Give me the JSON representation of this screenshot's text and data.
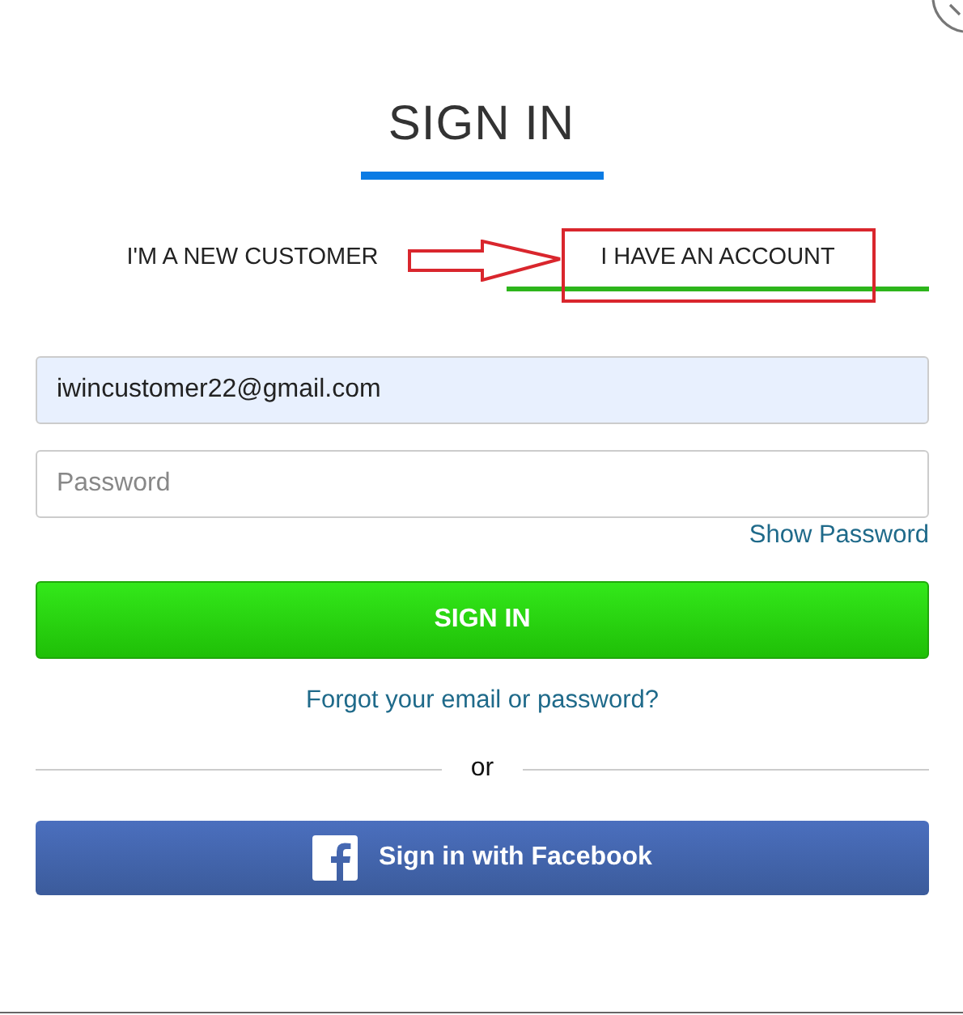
{
  "title": "SIGN IN",
  "tabs": [
    {
      "label": "I'M A NEW CUSTOMER",
      "selected": false
    },
    {
      "label": "I HAVE AN ACCOUNT",
      "selected": true
    }
  ],
  "email": {
    "value": "iwincustomer22@gmail.com",
    "autofilled": true
  },
  "password": {
    "placeholder": "Password"
  },
  "show_password": "Show Password",
  "sign_in_button": "SIGN IN",
  "forgot_link": "Forgot your email or password?",
  "divider": "or",
  "facebook_button": "Sign in with Facebook"
}
